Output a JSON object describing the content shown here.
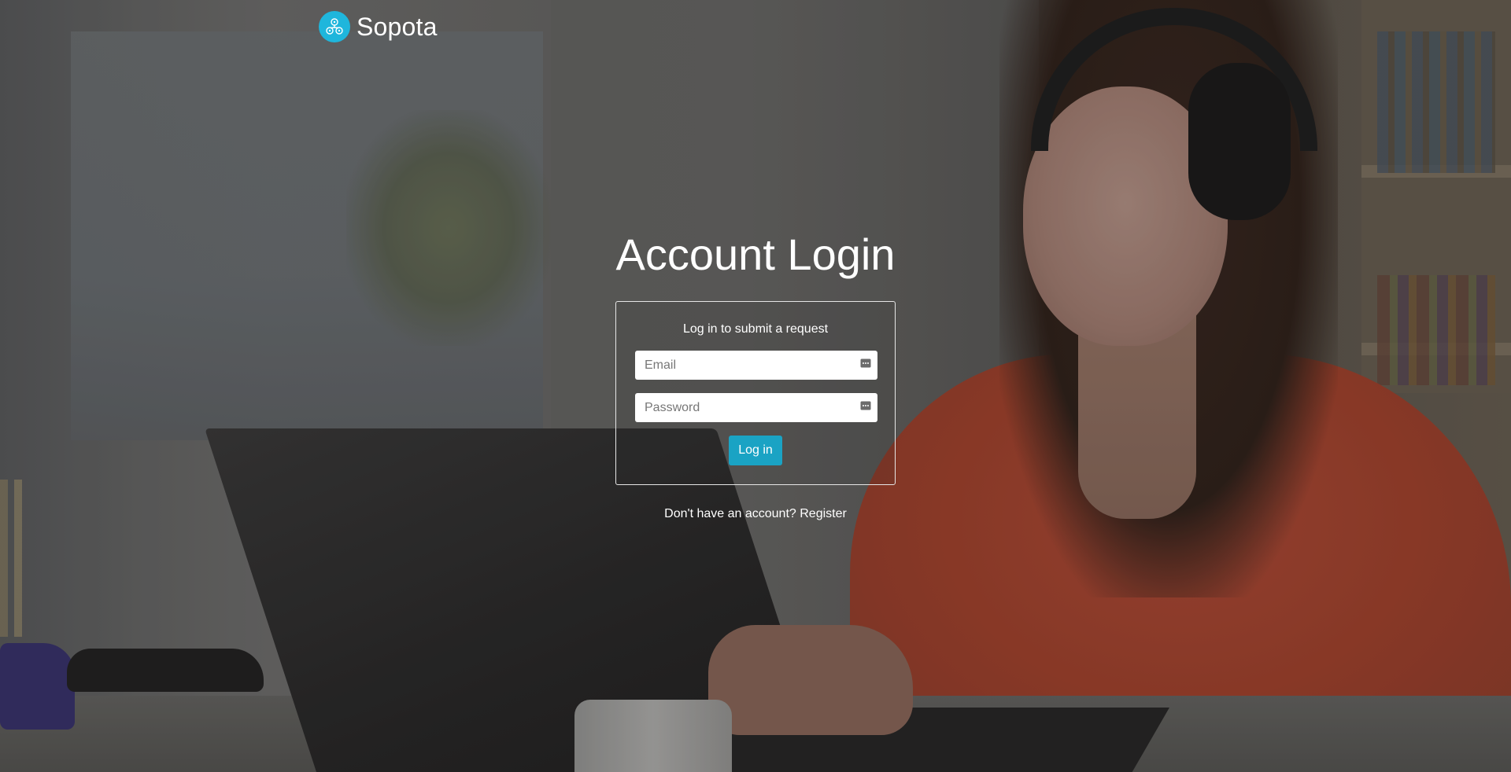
{
  "brand": {
    "name": "Sopota",
    "icon": "network-nodes-icon",
    "accent_color": "#1fb6dc"
  },
  "page": {
    "title": "Account Login"
  },
  "login_form": {
    "caption": "Log in to submit a request",
    "email": {
      "placeholder": "Email",
      "value": ""
    },
    "password": {
      "placeholder": "Password",
      "value": ""
    },
    "field_icon": "keypass-icon",
    "submit_label": "Log in",
    "button_color": "#1aa3c4"
  },
  "register": {
    "prompt": "Don't have an account?",
    "link_label": "Register"
  }
}
